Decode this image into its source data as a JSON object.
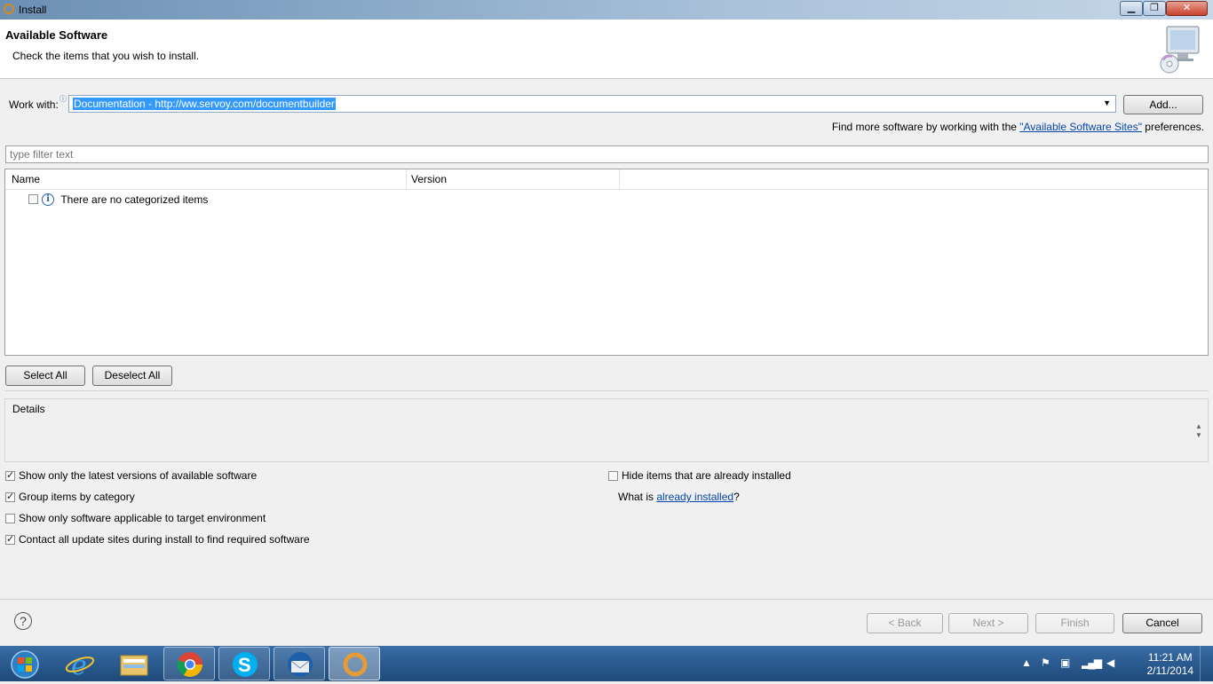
{
  "window": {
    "title": "Install"
  },
  "header": {
    "title": "Available Software",
    "subtitle": "Check the items that you wish to install."
  },
  "work_with": {
    "label": "Work with:",
    "value": "Documentation - http://ww.servoy.com/documentbuilder",
    "add_label": "Add...",
    "find_more_prefix": "Find more software by working with the ",
    "find_more_link": "\"Available Software Sites\"",
    "find_more_suffix": " preferences."
  },
  "filter": {
    "placeholder": "type filter text"
  },
  "tree": {
    "columns": [
      "Name",
      "Version"
    ],
    "empty_message": "There are no categorized items"
  },
  "selection": {
    "select_all": "Select All",
    "deselect_all": "Deselect All"
  },
  "details": {
    "label": "Details"
  },
  "options": {
    "latest_versions": {
      "label": "Show only the latest versions of available software",
      "checked": true
    },
    "group_by_category": {
      "label": "Group items by category",
      "checked": true
    },
    "target_env": {
      "label": "Show only software applicable to target environment",
      "checked": false
    },
    "contact_sites": {
      "label": "Contact all update sites during install to find required software",
      "checked": true
    },
    "hide_installed": {
      "label": "Hide items that are already installed",
      "checked": false
    },
    "what_is_prefix": "What is ",
    "already_installed_link": "already installed",
    "what_is_suffix": "?"
  },
  "footer": {
    "back": "< Back",
    "next": "Next >",
    "finish": "Finish",
    "cancel": "Cancel"
  },
  "taskbar": {
    "time": "11:21 AM",
    "date": "2/11/2014",
    "apps": [
      "windows-explorer",
      "internet-explorer",
      "chrome",
      "skype",
      "thunderbird",
      "eclipse"
    ]
  }
}
